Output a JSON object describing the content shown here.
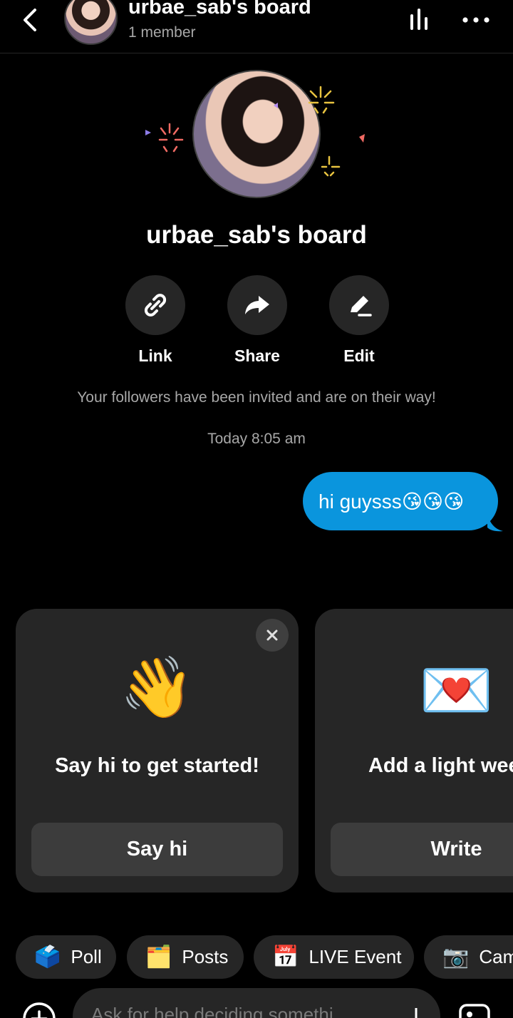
{
  "header": {
    "title": "urbae_sab's board",
    "subtitle": "1 member",
    "icons": [
      "back-icon",
      "bars-icon",
      "more-icon"
    ]
  },
  "board": {
    "title": "urbae_sab's board",
    "actions": [
      {
        "label": "Link",
        "icon": "link-icon"
      },
      {
        "label": "Share",
        "icon": "share-arrow-icon"
      },
      {
        "label": "Edit",
        "icon": "pencil-icon"
      }
    ],
    "invite_text": "Your followers have been invited and are on their way!",
    "timestamp": "Today 8:05 am"
  },
  "message": {
    "text": "hi guysss😘😘😘",
    "bubble_color": "#0a95dd"
  },
  "cards": [
    {
      "emoji": "👋",
      "text": "Say hi to get started!",
      "button": "Say hi",
      "close_icon": "close-icon"
    },
    {
      "emoji": "💌",
      "text": "Add a light weel note",
      "button": "Write"
    }
  ],
  "chips": [
    {
      "icon": "🗳️",
      "label": "Poll"
    },
    {
      "icon": "🗂️",
      "label": "Posts"
    },
    {
      "icon": "📅",
      "label": "LIVE Event"
    },
    {
      "icon": "📷",
      "label": "Cam"
    }
  ],
  "composer": {
    "placeholder": "Ask for help deciding somethi"
  },
  "colors": {
    "background": "#000000",
    "surface": "#262626",
    "accent": "#0a95dd",
    "muted_text": "#a8a8a8"
  }
}
